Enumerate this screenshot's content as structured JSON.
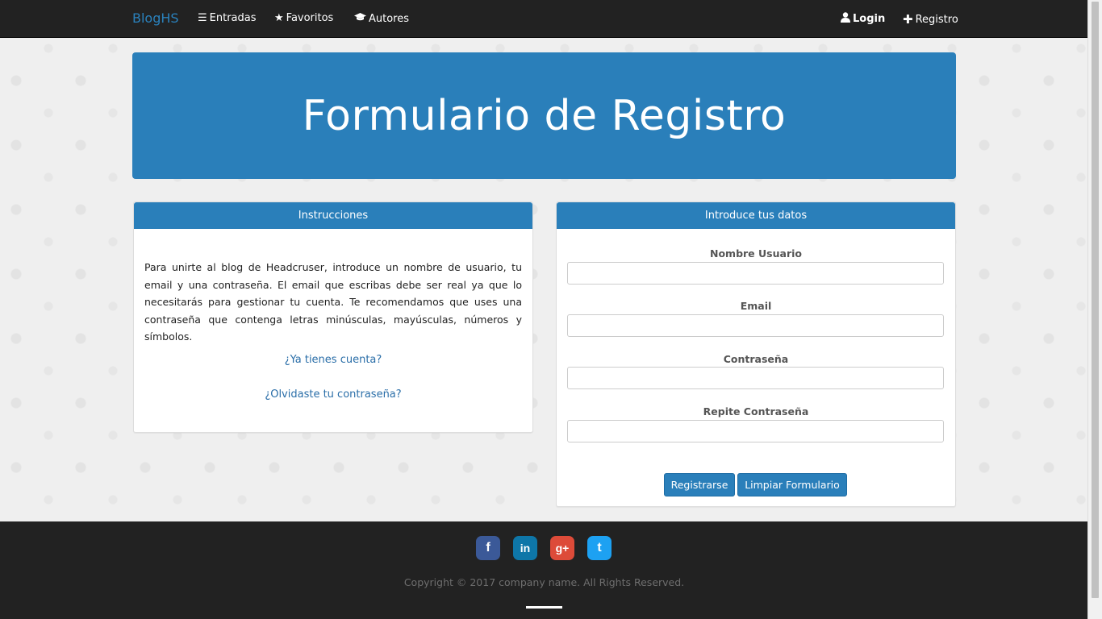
{
  "navbar": {
    "brand": "BlogHS",
    "entradas": "Entradas",
    "favoritos": "Favoritos",
    "autores": "Autores",
    "login": "Login",
    "registro": "Registro"
  },
  "jumbotron": {
    "title": "Formulario de Registro"
  },
  "instructions": {
    "heading": "Instrucciones",
    "text": "Para unirte al blog de Headcruser, introduce un nombre de usuario, tu email y una contraseña. El email que escribas debe ser real ya que lo necesitarás para gestionar tu cuenta. Te recomendamos que uses una contraseña que contenga letras minúsculas, mayúsculas, números y símbolos.",
    "have_account": "¿Ya tienes cuenta?",
    "forgot_password": "¿Olvidaste tu contraseña?"
  },
  "form": {
    "heading": "Introduce tus datos",
    "username_label": "Nombre Usuario",
    "username_value": "",
    "email_label": "Email",
    "email_value": "",
    "password_label": "Contraseña",
    "password_value": "",
    "repeat_password_label": "Repite Contraseña",
    "repeat_password_value": "",
    "submit_label": "Registrarse",
    "reset_label": "Limpiar Formulario"
  },
  "footer": {
    "social": [
      {
        "name": "facebook-icon",
        "glyph": "f",
        "color": "#3b5998"
      },
      {
        "name": "linkedin-icon",
        "glyph": "in",
        "color": "#0e76a8"
      },
      {
        "name": "google-plus-icon",
        "glyph": "g+",
        "color": "#dd4b39"
      },
      {
        "name": "twitter-icon",
        "glyph": "t",
        "color": "#1da1f2"
      }
    ],
    "copyright": "Copyright © 2017 company name. All Rights Reserved."
  },
  "colors": {
    "primary": "#2a7fba",
    "navbar": "#222222",
    "brand": "#2a81bc"
  }
}
